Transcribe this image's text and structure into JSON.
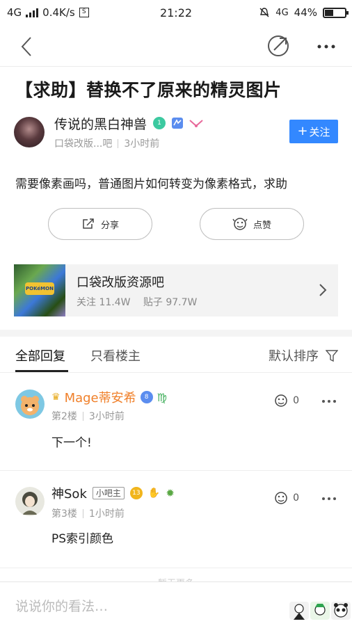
{
  "status_bar": {
    "network": "4G",
    "speed": "0.4K/s",
    "sim_icon": "S",
    "time": "21:22",
    "mute_icon": "mute-alarm-icon",
    "network_right": "4G",
    "battery": "44%",
    "battery_level": 0.44
  },
  "nav": {
    "back_icon": "back-icon",
    "share_icon": "share-icon",
    "more_icon": "more-icon"
  },
  "post": {
    "title": "【求助】替换不了原来的精灵图片",
    "author": "传说的黑白神兽",
    "author_level": "1",
    "forum_short": "口袋改版...吧",
    "time": "3小时前",
    "follow_label": "关注",
    "body": "需要像素画吗，普通图片如何转变为像素格式，求助"
  },
  "actions": {
    "share_label": "分享",
    "like_label": "点赞"
  },
  "forum": {
    "name": "口袋改版资源吧",
    "followers": "关注 11.4W",
    "posts": "贴子 97.7W",
    "logo_text": "POKéMON"
  },
  "tabs": {
    "all": "全部回复",
    "op_only": "只看楼主",
    "sort": "默认排序"
  },
  "replies": [
    {
      "name": "Mage蒂安希",
      "level": "8",
      "zodiac": "♍",
      "floor": "第2楼",
      "time": "3小时前",
      "text": "下一个!",
      "likes": "0",
      "name_color": "#f0802a"
    },
    {
      "name": "神Sok",
      "role": "小吧主",
      "level": "13",
      "floor": "第3楼",
      "time": "1小时前",
      "text": "PS索引颜色",
      "likes": "0",
      "name_color": "#222222"
    }
  ],
  "more_hint": "暂无更多",
  "comment": {
    "placeholder": "说说你的看法…"
  }
}
